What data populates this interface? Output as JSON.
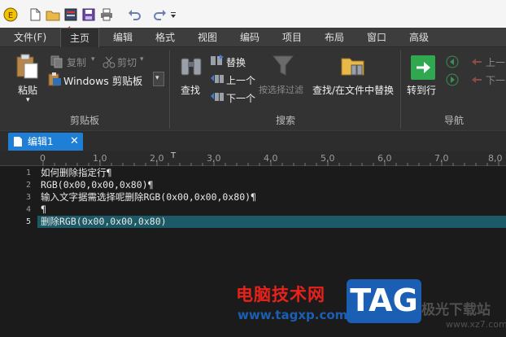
{
  "menu": {
    "items": [
      "文件(F)",
      "主页",
      "编辑",
      "格式",
      "视图",
      "编码",
      "项目",
      "布局",
      "窗口",
      "高级"
    ],
    "active_index": 1
  },
  "ribbon": {
    "clipboard": {
      "paste": "粘贴",
      "copy": "复制",
      "cut": "剪切",
      "windows_clipboard": "Windows 剪贴板",
      "group_label": "剪贴板"
    },
    "search": {
      "find": "查找",
      "replace": "替换",
      "prev": "上一个",
      "next": "下一个",
      "filter": "按选择过滤",
      "find_in_files": "查找/在文件中替换",
      "group_label": "搜索"
    },
    "navigation": {
      "goto_line": "转到行",
      "prev": "上一",
      "next": "下一",
      "group_label": "导航"
    }
  },
  "document_tab": {
    "label": "编辑1",
    "close": "✕"
  },
  "ruler": {
    "labels": [
      "0",
      "1,0",
      "2,0",
      "3,0",
      "4,0",
      "5,0",
      "6,0",
      "7,0",
      "8,0"
    ]
  },
  "editor": {
    "line_numbers": [
      "1",
      "2",
      "3",
      "4",
      "5"
    ],
    "lines": [
      "如何删除指定行¶",
      "RGB(0x00,0x00,0x80)¶",
      "输入文字据需选择呢删除RGB(0x00,0x00,0x80)¶",
      "¶",
      "删除RGB(0x00,0x00,0x80)"
    ],
    "highlight_line": 5
  },
  "watermark": {
    "site_name": "电脑技术网",
    "url": "www.tagxp.com",
    "tag": "TAG",
    "right_text": "极光下载站",
    "right_url": "www.xz7.com"
  },
  "colors": {
    "accent_tab": "#1f7ed6",
    "highlight_line": "#1b5a66",
    "goto_green": "#2fa84f",
    "arrow_red": "#e53935",
    "watermark_red": "#e8221b",
    "watermark_blue": "#1a5fb4"
  }
}
